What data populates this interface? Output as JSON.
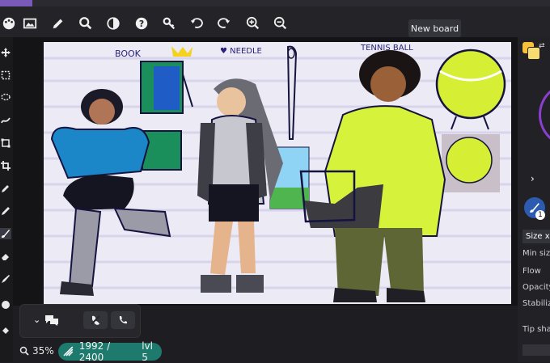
{
  "toolbar": {
    "new_board_label": "New board",
    "icons": [
      "palette-icon",
      "image-icon",
      "pencil-icon",
      "search-icon",
      "contrast-icon",
      "help-icon",
      "key-icon",
      "undo-icon",
      "redo-icon",
      "zoom-in-icon",
      "zoom-out-icon"
    ]
  },
  "left_tools": [
    "move-icon",
    "rect-select-icon",
    "lasso-icon",
    "smudge-icon",
    "transform-icon",
    "crop-icon",
    "eyedropper-icon",
    "pen-icon",
    "brush-icon",
    "eraser-icon",
    "blend-icon",
    "bucket-icon",
    "fill-icon"
  ],
  "canvas": {
    "labels": [
      "BOOK",
      "♥ NEEDLE",
      "TENNIS BALL"
    ]
  },
  "right_panel": {
    "brush_badge": "1",
    "size_label": "Size x",
    "min_size_label": "Min size",
    "flow_label": "Flow",
    "opacity_label": "Opacity",
    "stabilizer_label": "Stabiliz",
    "tip_shape_label": "Tip sha",
    "primary_color": "#f5c23a",
    "secondary_color": "#f7dc6f"
  },
  "chat": {
    "icons": [
      "chevron-down-icon",
      "chat-bubbles-icon",
      "mute-icon",
      "phone-icon"
    ]
  },
  "status": {
    "zoom": "35%",
    "size_readout": "1992 / 2400",
    "level": "lvl 5"
  },
  "colors": {
    "accent": "#1f7a6e",
    "canvas_bg": "#eceaf5",
    "app_bg": "#1e1e22"
  }
}
